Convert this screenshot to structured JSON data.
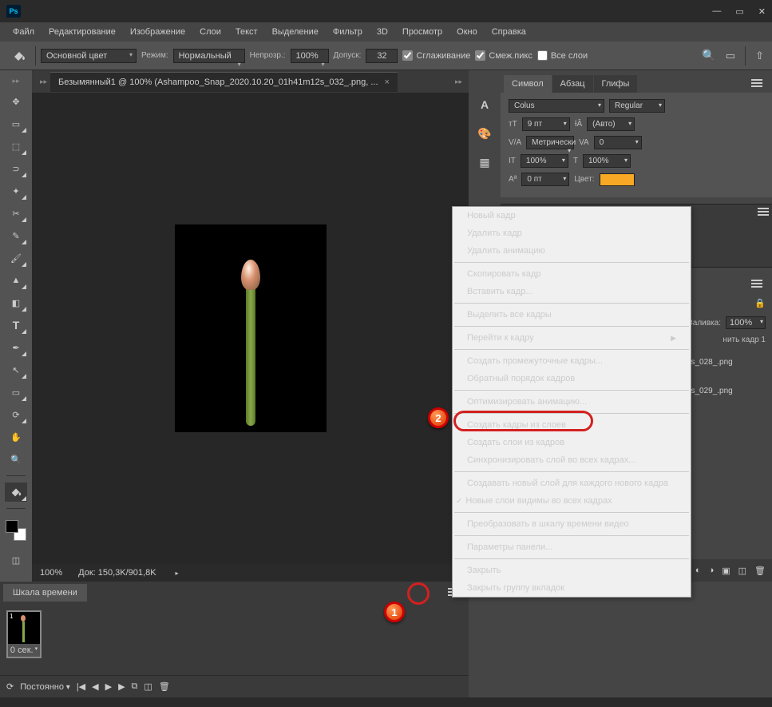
{
  "titlebar": {
    "logo": "Ps"
  },
  "menubar": [
    "Файл",
    "Редактирование",
    "Изображение",
    "Слои",
    "Текст",
    "Выделение",
    "Фильтр",
    "3D",
    "Просмотр",
    "Окно",
    "Справка"
  ],
  "options": {
    "fill_label": "Основной цвет",
    "mode_lbl": "Режим:",
    "mode": "Нормальный",
    "opacity_lbl": "Непрозр.:",
    "opacity": "100%",
    "tolerance_lbl": "Допуск:",
    "tolerance": "32",
    "antialias": "Сглаживание",
    "contiguous": "Смеж.пикс",
    "all_layers": "Все слои"
  },
  "doc": {
    "tab": "Безымянный1 @ 100% (Ashampoo_Snap_2020.10.20_01h41m12s_032_.png, ...",
    "zoom": "100%",
    "size": "Док: 150,3K/901,8K"
  },
  "char_panel": {
    "tabs": [
      "Символ",
      "Абзац",
      "Глифы"
    ],
    "font": "Colus",
    "style": "Regular",
    "size": "9 пт",
    "leading": "(Авто)",
    "kerning": "Метрически",
    "tracking": "0",
    "vscale": "100%",
    "hscale": "100%",
    "baseline": "0 пт",
    "color_lbl": "Цвет:",
    "color": "#f7a824"
  },
  "layers": {
    "fill_lbl": "Заливка:",
    "fill": "100%",
    "save_frame": "нить кадр 1",
    "items": [
      "Ashampoo_Snap_2020...._01h40m41s_028_.png",
      "Ashampoo_Snap_2020...._01h40m51s_029_.png"
    ]
  },
  "timeline": {
    "title": "Шкала времени",
    "frame_num": "1",
    "frame_dur": "0 сек.",
    "loop": "Постоянно"
  },
  "context_menu": {
    "items": [
      {
        "t": "Новый кадр",
        "d": false
      },
      {
        "t": "Удалить кадр",
        "d": true
      },
      {
        "t": "Удалить анимацию",
        "d": true
      },
      {
        "sep": true
      },
      {
        "t": "Скопировать кадр",
        "d": false
      },
      {
        "t": "Вставить кадр...",
        "d": true
      },
      {
        "sep": true
      },
      {
        "t": "Выделить все кадры",
        "d": false
      },
      {
        "sep": true
      },
      {
        "t": "Перейти к кадру",
        "d": false,
        "sub": true
      },
      {
        "sep": true
      },
      {
        "t": "Создать промежуточные кадры...",
        "d": true
      },
      {
        "t": "Обратный порядок кадров",
        "d": true
      },
      {
        "sep": true
      },
      {
        "t": "Оптимизировать анимацию...",
        "d": false
      },
      {
        "sep": true
      },
      {
        "t": "Создать кадры из слоев",
        "d": false,
        "hl": true
      },
      {
        "t": "Создать слои из кадров",
        "d": false
      },
      {
        "t": "Синхронизировать слой во всех кадрах...",
        "d": true
      },
      {
        "sep": true
      },
      {
        "t": "Создавать новый слой для каждого нового кадра",
        "d": false
      },
      {
        "t": "Новые слои видимы во всех кадрах",
        "d": false,
        "chk": true
      },
      {
        "sep": true
      },
      {
        "t": "Преобразовать в шкалу времени видео",
        "d": false
      },
      {
        "sep": true
      },
      {
        "t": "Параметры панели...",
        "d": false
      },
      {
        "sep": true
      },
      {
        "t": "Закрыть",
        "d": false
      },
      {
        "t": "Закрыть группу вкладок",
        "d": false
      }
    ]
  },
  "callouts": {
    "c1": "1",
    "c2": "2"
  }
}
